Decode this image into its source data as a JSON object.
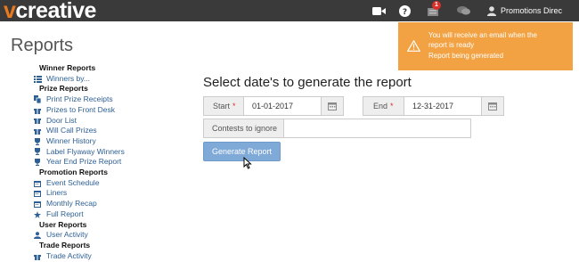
{
  "app": {
    "logo_v": "v",
    "logo_rest": "creative"
  },
  "topbar": {
    "icons": [
      "video-camera-icon",
      "help-circle-icon",
      "notifications-icon",
      "chat-icon",
      "user-icon"
    ],
    "notification_count": "1",
    "user_label": "Promotions Direc"
  },
  "page": {
    "title": "Reports"
  },
  "sidebar": {
    "sections": [
      {
        "heading": "Winner Reports",
        "items": [
          {
            "label": "Winners by...",
            "icon": "list-icon"
          }
        ]
      },
      {
        "heading": "Prize Reports",
        "items": [
          {
            "label": "Print Prize Receipts",
            "icon": "copy-icon"
          },
          {
            "label": "Prizes to Front Desk",
            "icon": "gift-icon"
          },
          {
            "label": "Door List",
            "icon": "gift-icon"
          },
          {
            "label": "Will Call Prizes",
            "icon": "gift-icon"
          },
          {
            "label": "Winner History",
            "icon": "trophy-icon"
          },
          {
            "label": "Label Flyaway Winners",
            "icon": "trophy-icon"
          },
          {
            "label": "Year End Prize Report",
            "icon": "trophy-icon"
          }
        ]
      },
      {
        "heading": "Promotion Reports",
        "items": [
          {
            "label": "Event Schedule",
            "icon": "calendar-icon"
          },
          {
            "label": "Liners",
            "icon": "calendar-icon"
          },
          {
            "label": "Monthly Recap",
            "icon": "calendar-icon"
          },
          {
            "label": "Full Report",
            "icon": "star-icon"
          }
        ]
      },
      {
        "heading": "User Reports",
        "items": [
          {
            "label": "User Activity",
            "icon": "user-icon"
          }
        ]
      },
      {
        "heading": "Trade Reports",
        "items": [
          {
            "label": "Trade Activity",
            "icon": "gift-icon"
          }
        ]
      }
    ]
  },
  "form": {
    "title": "Select date's to generate the report",
    "start_label": "Start",
    "start_value": "01-01-2017",
    "end_label": "End",
    "end_value": "12-31-2017",
    "required_mark": "*",
    "contests_label": "Contests to ignore",
    "contests_value": "",
    "generate_button": "Generate Report"
  },
  "toast": {
    "line1": "You will receive an email when the",
    "line2": "report is ready",
    "line3": "Report being generated"
  },
  "colors": {
    "topbar": "#3a3a3a",
    "logo_accent": "#e8791f",
    "link": "#2d5f94",
    "button": "#7fa9d6",
    "toast": "#f2a243",
    "badge": "#d9302b"
  }
}
